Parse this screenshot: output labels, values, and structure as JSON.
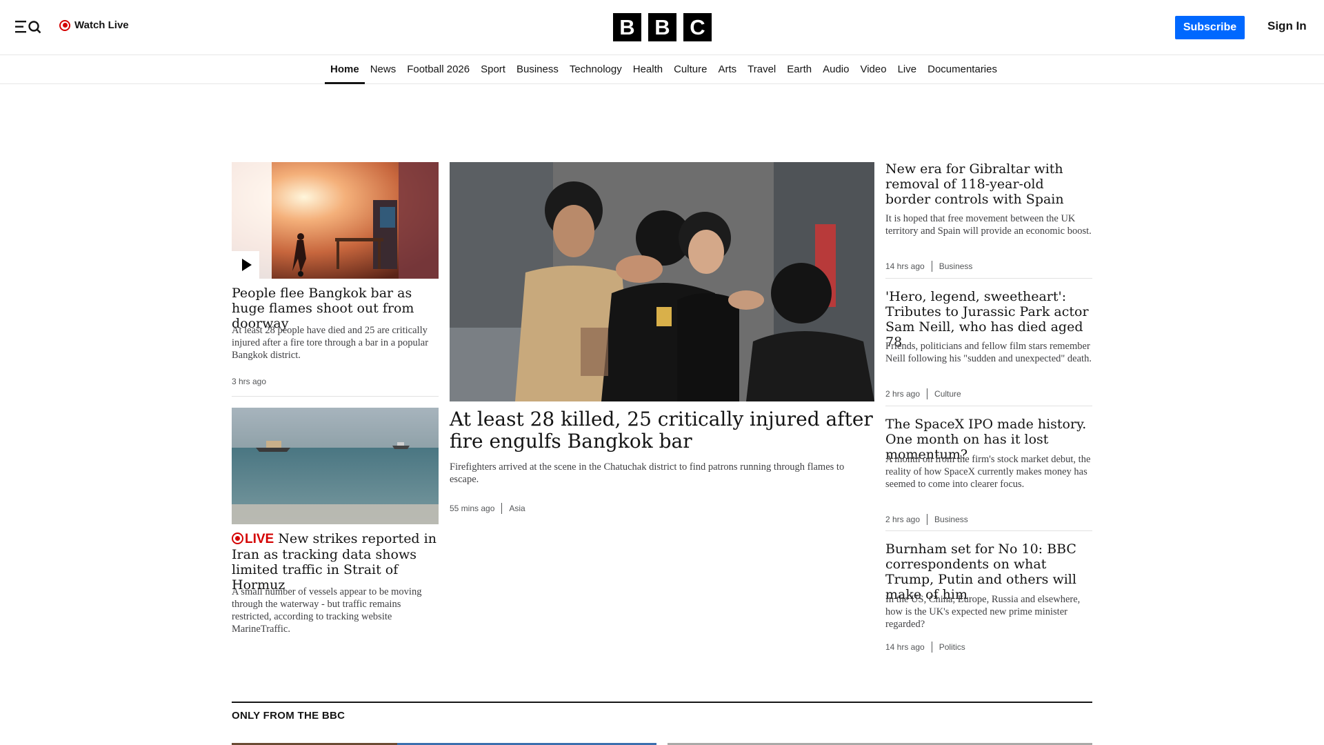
{
  "header": {
    "watch_live": "Watch Live",
    "logo_letters": [
      "B",
      "B",
      "C"
    ],
    "subscribe": "Subscribe",
    "sign_in": "Sign In"
  },
  "nav": {
    "items": [
      "Home",
      "News",
      "Football 2026",
      "Sport",
      "Business",
      "Technology",
      "Health",
      "Culture",
      "Arts",
      "Travel",
      "Earth",
      "Audio",
      "Video",
      "Live",
      "Documentaries"
    ],
    "active": "Home"
  },
  "stories": {
    "left1": {
      "headline": "People flee Bangkok bar as huge flames shoot out from doorway",
      "summary": "At least 28 people have died and 25 are critically injured after a fire tore through a bar in a popular Bangkok district.",
      "time": "3 hrs ago"
    },
    "left2": {
      "live_label": "LIVE",
      "headline": "New strikes reported in Iran as tracking data shows limited traffic in Strait of Hormuz",
      "summary": "A small number of vessels appear to be moving through the waterway - but traffic remains restricted, according to tracking website MarineTraffic."
    },
    "main": {
      "headline": "At least 28 killed, 25 critically injured after fire engulfs Bangkok bar",
      "summary": "Firefighters arrived at the scene in the Chatuchak district to find patrons running through flames to escape.",
      "time": "55 mins ago",
      "tag": "Asia"
    },
    "right": [
      {
        "headline": "New era for Gibraltar with removal of 118-year-old border controls with Spain",
        "summary": "It is hoped that free movement between the UK territory and Spain will provide an economic boost.",
        "time": "14 hrs ago",
        "tag": "Business"
      },
      {
        "headline": "'Hero, legend, sweetheart': Tributes to Jurassic Park actor Sam Neill, who has died aged 78",
        "summary": "Friends, politicians and fellow film stars remember Neill following his \"sudden and unexpected\" death.",
        "time": "2 hrs ago",
        "tag": "Culture"
      },
      {
        "headline": "The SpaceX IPO made history. One month on has it lost momentum?",
        "summary": "A month on from the firm's stock market debut, the reality of how SpaceX currently makes money has seemed to come into clearer focus.",
        "time": "2 hrs ago",
        "tag": "Business"
      },
      {
        "headline": "Burnham set for No 10: BBC correspondents on what Trump, Putin and others will make of him",
        "summary": "In the US, China, Europe, Russia and elsewhere, how is the UK's expected new prime minister regarded?",
        "time": "14 hrs ago",
        "tag": "Politics"
      }
    ]
  },
  "section": {
    "title": "ONLY FROM THE BBC"
  },
  "colors": {
    "accent": "#0068ff",
    "live": "#d40000",
    "text": "#141414"
  }
}
